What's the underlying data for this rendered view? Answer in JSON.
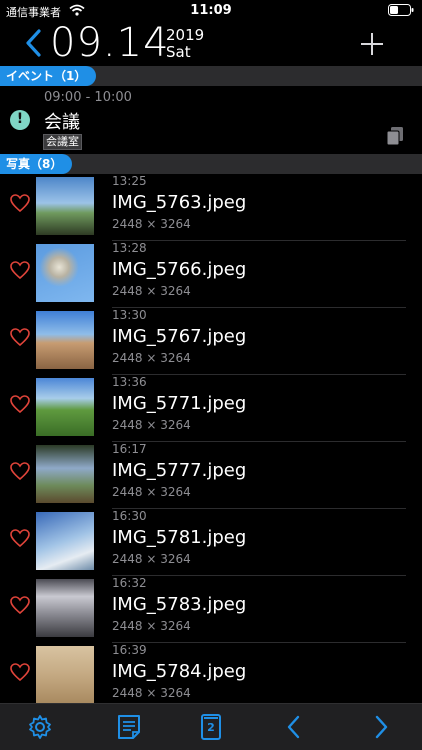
{
  "status": {
    "carrier": "通信事業者",
    "time": "11:09"
  },
  "header": {
    "date": "09.14",
    "year": "2019",
    "weekday": "Sat"
  },
  "events_section": {
    "label": "イベント（1）"
  },
  "event": {
    "time_range": "09:00 - 10:00",
    "title": "会議",
    "tag": "会議室"
  },
  "photos_section": {
    "label": "写真（8）"
  },
  "photos": [
    {
      "time": "13:25",
      "name": "IMG_5763.jpeg",
      "size": "2448 × 3264"
    },
    {
      "time": "13:28",
      "name": "IMG_5766.jpeg",
      "size": "2448 × 3264"
    },
    {
      "time": "13:30",
      "name": "IMG_5767.jpeg",
      "size": "2448 × 3264"
    },
    {
      "time": "13:36",
      "name": "IMG_5771.jpeg",
      "size": "2448 × 3264"
    },
    {
      "time": "16:17",
      "name": "IMG_5777.jpeg",
      "size": "2448 × 3264"
    },
    {
      "time": "16:30",
      "name": "IMG_5781.jpeg",
      "size": "2448 × 3264"
    },
    {
      "time": "16:32",
      "name": "IMG_5783.jpeg",
      "size": "2448 × 3264"
    },
    {
      "time": "16:39",
      "name": "IMG_5784.jpeg",
      "size": "2448 × 3264"
    }
  ],
  "toolbar": {
    "page_badge": "2"
  },
  "colors": {
    "accent": "#1f8fe6",
    "heart": "#e0443a",
    "alert": "#7fd6c6"
  },
  "icons": [
    "back-chevron-icon",
    "plus-icon",
    "alert-icon",
    "copy-icon",
    "heart-icon",
    "gear-icon",
    "document-icon",
    "page-icon",
    "chevron-left-icon",
    "chevron-right-icon"
  ]
}
